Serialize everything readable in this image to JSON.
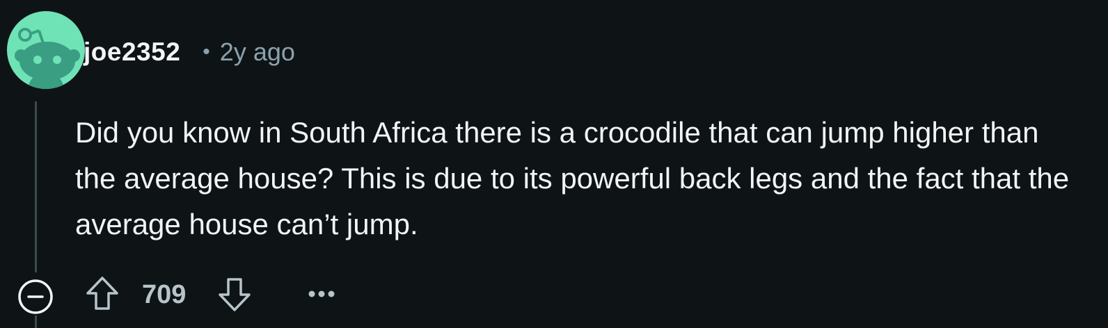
{
  "comment": {
    "author": "joe2352",
    "separator": "•",
    "age": "2y ago",
    "body": "Did you know in South Africa there is a crocodile that can jump higher than the average house? This is due to its powerful back legs and the fact that the average house can’t jump.",
    "score": "709"
  },
  "icons": {
    "avatar": "reddit-snoo-avatar-icon",
    "collapse": "collapse-circle-minus-icon",
    "upvote": "arrow-up-outline-icon",
    "downvote": "arrow-down-outline-icon",
    "more": "ellipsis-horizontal-icon"
  },
  "colors": {
    "background": "#0e1416",
    "avatar_background": "#6fe3b5",
    "avatar_snoo": "#3a9e82",
    "text_primary": "#f2f4f5",
    "text_secondary": "#8ba2ad",
    "icon": "#b7c4ca"
  }
}
